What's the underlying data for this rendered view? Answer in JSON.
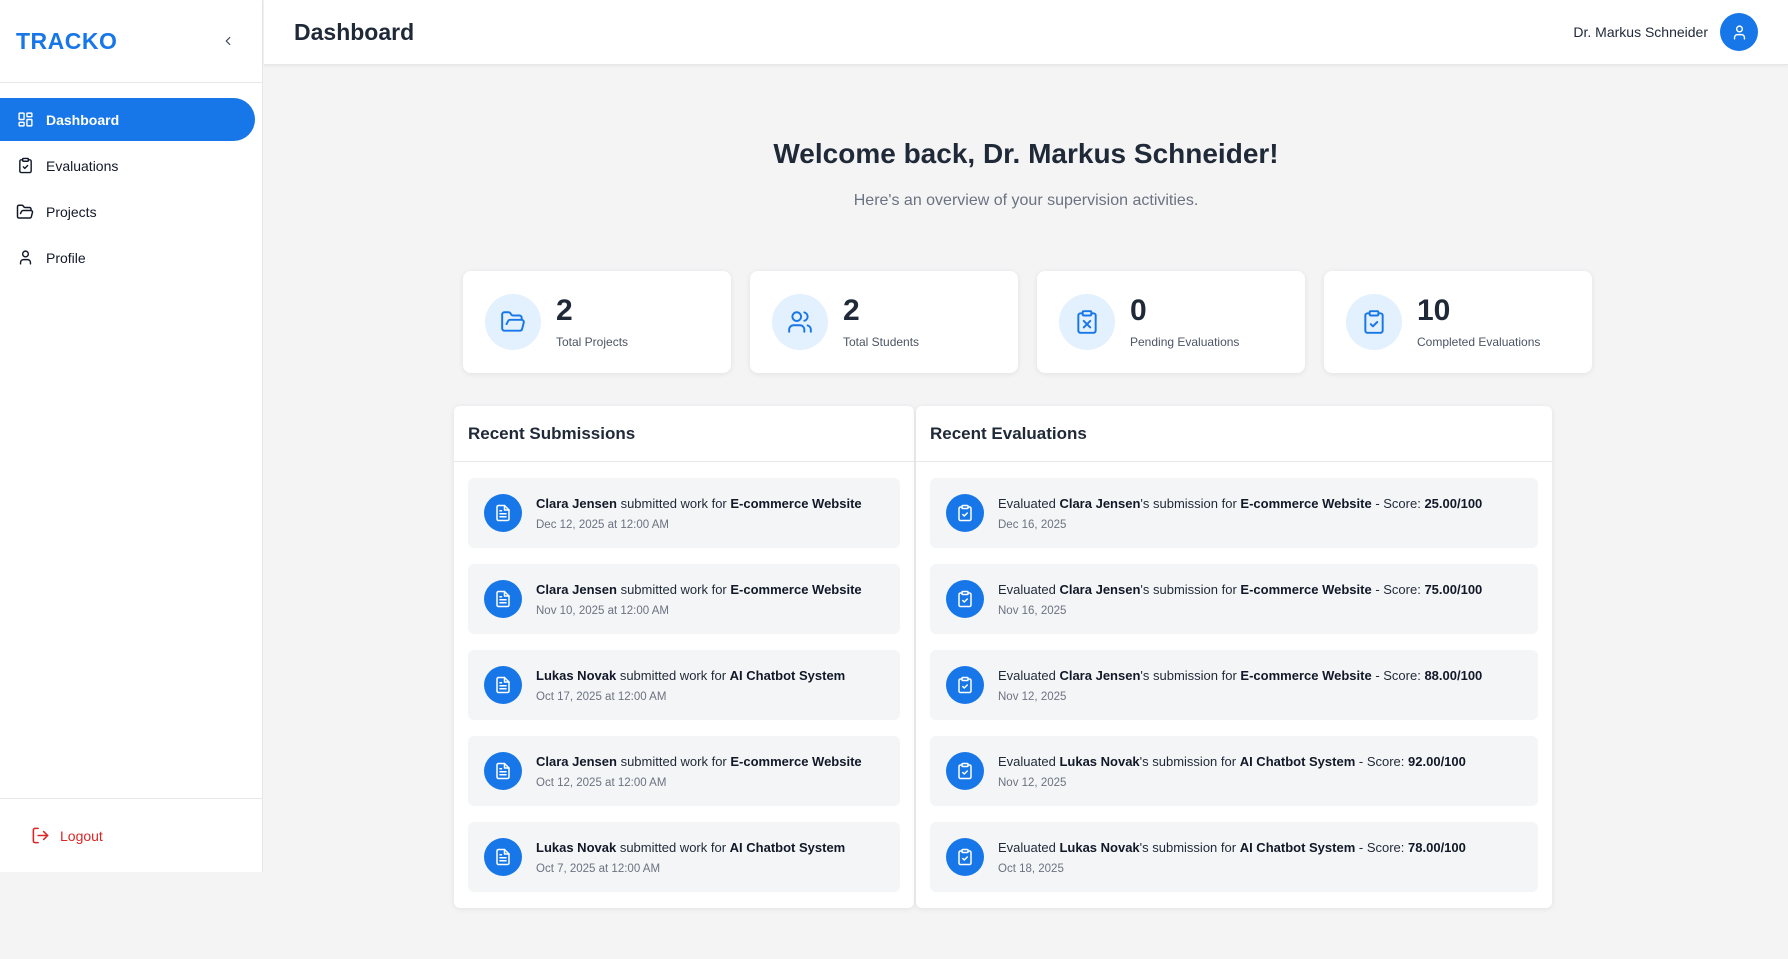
{
  "brand": "TRACKO",
  "nav": [
    {
      "label": "Dashboard",
      "icon": "grid-icon",
      "active": true
    },
    {
      "label": "Evaluations",
      "icon": "clipboard-check-icon"
    },
    {
      "label": "Projects",
      "icon": "folder-open-icon"
    },
    {
      "label": "Profile",
      "icon": "user-icon"
    }
  ],
  "logout_label": "Logout",
  "header": {
    "title": "Dashboard",
    "user_name": "Dr. Markus Schneider"
  },
  "welcome": {
    "title": "Welcome back, Dr. Markus Schneider!",
    "subtitle": "Here's an overview of your supervision activities."
  },
  "stats": [
    {
      "value": "2",
      "label": "Total Projects",
      "icon": "folder-open-icon"
    },
    {
      "value": "2",
      "label": "Total Students",
      "icon": "users-icon"
    },
    {
      "value": "0",
      "label": "Pending Evaluations",
      "icon": "clipboard-x-icon"
    },
    {
      "value": "10",
      "label": "Completed Evaluations",
      "icon": "clipboard-check-icon"
    }
  ],
  "recent_submissions": {
    "title": "Recent Submissions",
    "verb": "submitted work for",
    "items": [
      {
        "student": "Clara Jensen",
        "project": "E-commerce Website",
        "date": "Dec 12, 2025 at 12:00 AM"
      },
      {
        "student": "Clara Jensen",
        "project": "E-commerce Website",
        "date": "Nov 10, 2025 at 12:00 AM"
      },
      {
        "student": "Lukas Novak",
        "project": "AI Chatbot System",
        "date": "Oct 17, 2025 at 12:00 AM"
      },
      {
        "student": "Clara Jensen",
        "project": "E-commerce Website",
        "date": "Oct 12, 2025 at 12:00 AM"
      },
      {
        "student": "Lukas Novak",
        "project": "AI Chatbot System",
        "date": "Oct 7, 2025 at 12:00 AM"
      }
    ]
  },
  "recent_evaluations": {
    "title": "Recent Evaluations",
    "prefix": "Evaluated",
    "possessive": "'s submission for",
    "score_prefix": "- Score:",
    "items": [
      {
        "student": "Clara Jensen",
        "project": "E-commerce Website",
        "score": "25.00/100",
        "date": "Dec 16, 2025"
      },
      {
        "student": "Clara Jensen",
        "project": "E-commerce Website",
        "score": "75.00/100",
        "date": "Nov 16, 2025"
      },
      {
        "student": "Clara Jensen",
        "project": "E-commerce Website",
        "score": "88.00/100",
        "date": "Nov 12, 2025"
      },
      {
        "student": "Lukas Novak",
        "project": "AI Chatbot System",
        "score": "92.00/100",
        "date": "Nov 12, 2025"
      },
      {
        "student": "Lukas Novak",
        "project": "AI Chatbot System",
        "score": "78.00/100",
        "date": "Oct 18, 2025"
      }
    ]
  },
  "colors": {
    "accent": "#1877e8",
    "danger": "#dc2626",
    "icon_bg": "#e3f0fd"
  }
}
